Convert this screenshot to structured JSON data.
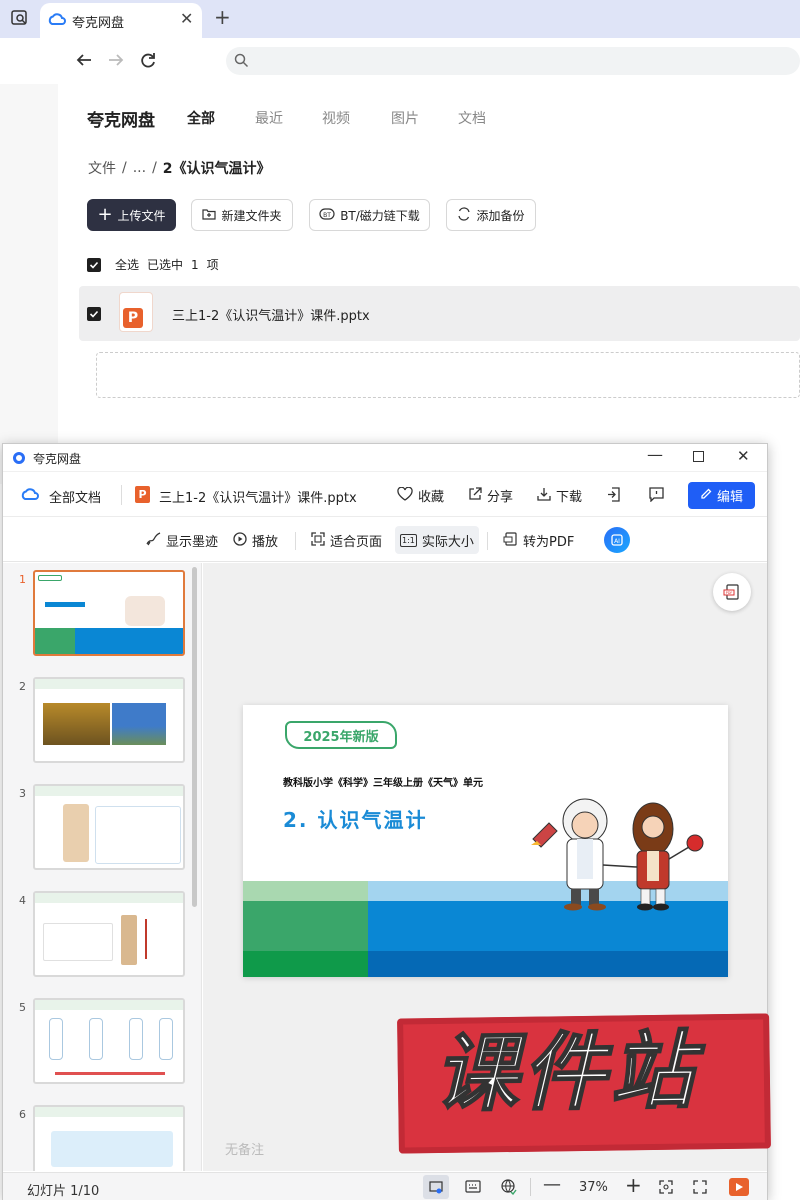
{
  "browser": {
    "tab_title": "夸克网盘"
  },
  "pan": {
    "brand": "夸克网盘",
    "nav_tabs": [
      "全部",
      "最近",
      "视频",
      "图片",
      "文档"
    ],
    "breadcrumb": {
      "root": "文件",
      "sep1": "/",
      "ellipsis": "...",
      "sep2": "/",
      "current": "2《认识气温计》"
    },
    "actions": {
      "upload": "上传文件",
      "new_folder": "新建文件夹",
      "bt": "BT/磁力链下载",
      "backup": "添加备份"
    },
    "select_all": "全选",
    "selected_prefix": "已选中",
    "selected_count": "1",
    "selected_suffix": "项",
    "file_name": "三上1-2《认识气温计》课件.pptx",
    "file_icon_letter": "P"
  },
  "viewer": {
    "window_title": "夸克网盘",
    "all_docs": "全部文档",
    "doc_title": "三上1-2《认识气温计》课件.pptx",
    "doc_icon_letter": "P",
    "collect": "收藏",
    "share": "分享",
    "download": "下载",
    "edit": "编辑",
    "tools": {
      "ink": "显示墨迹",
      "play": "播放",
      "fit": "适合页面",
      "actual": "实际大小",
      "to_pdf": "转为PDF"
    },
    "thumb_numbers": [
      "1",
      "2",
      "3",
      "4",
      "5",
      "6"
    ],
    "slide": {
      "badge": "2025年新版",
      "subtitle": "教科版小学《科学》三年级上册《天气》单元",
      "title": "2. 认识气温计"
    },
    "notes_placeholder": "无备注",
    "slide_counter": "幻灯片 1/10",
    "zoom": "37%",
    "watermark": "课件站"
  },
  "colors": {
    "accent_blue": "#1f5ef6",
    "dark_button": "#2e3142",
    "slide_green": "#3aa66a",
    "slide_blue": "#0a87d4",
    "watermark_red": "#d9333f"
  }
}
